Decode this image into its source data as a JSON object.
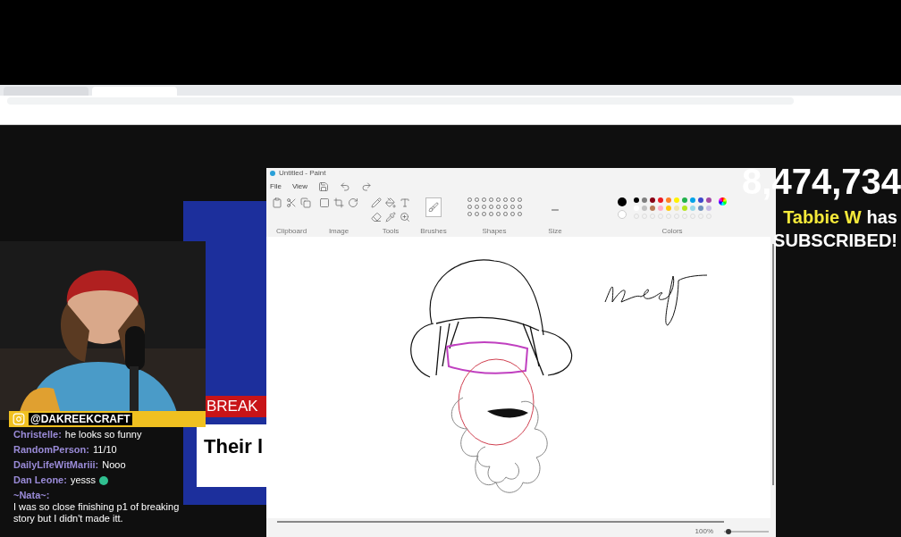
{
  "browser": {
    "tabs": [
      {
        "selected": false
      },
      {
        "selected": true
      }
    ]
  },
  "paint": {
    "title": "Untitled - Paint",
    "menu": [
      "File",
      "View"
    ],
    "groups": [
      "Clipboard",
      "Image",
      "Tools",
      "Brushes",
      "Shapes",
      "Size",
      "Colors"
    ],
    "palette": [
      {
        "color": "#000000"
      },
      {
        "color": "#7f7f7f"
      },
      {
        "color": "#880015"
      },
      {
        "color": "#ed1c24"
      },
      {
        "color": "#ff7f27"
      },
      {
        "color": "#fff200"
      },
      {
        "color": "#22b14c"
      },
      {
        "color": "#00a2e8"
      },
      {
        "color": "#3f48cc"
      },
      {
        "color": "#a349a4"
      },
      {
        "color": "#ffffff"
      },
      {
        "color": "#c3c3c3"
      },
      {
        "color": "#b97a57"
      },
      {
        "color": "#ffaec9"
      },
      {
        "color": "#ffc90e"
      },
      {
        "color": "#efe4b0"
      },
      {
        "color": "#b5e61d"
      },
      {
        "color": "#99d9ea"
      },
      {
        "color": "#7092be"
      },
      {
        "color": "#c8bfe7"
      }
    ],
    "zoom": "100%",
    "zoom_slider": {
      "level": 0.1
    }
  },
  "stream": {
    "handle": "@DAKREEKCRAFT",
    "news": {
      "banner": "BREAK",
      "headline": "Their l"
    },
    "counter": "8,474,734",
    "alert": {
      "name": "Tabbie W",
      "text": "has",
      "action": "SUBSCRIBED!"
    },
    "chat": [
      {
        "user": "Christelle:",
        "message": "he looks so funny"
      },
      {
        "user": "RandomPerson:",
        "message": "11/10"
      },
      {
        "user": "DailyLifeWitMariii:",
        "message": "Nooo"
      },
      {
        "user": "Dan Leone:",
        "message": "yesss"
      },
      {
        "user": "~Nata~:",
        "message": "I was so close finishing p1 of breaking story but I didn't made itt."
      }
    ]
  }
}
